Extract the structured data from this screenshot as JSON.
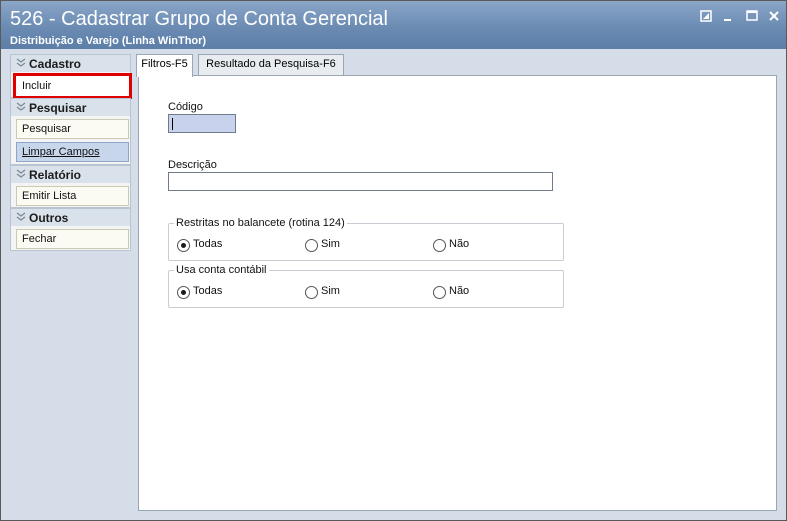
{
  "window": {
    "title": "526 - Cadastrar Grupo de Conta Gerencial",
    "subtitle": "Distribuição e Varejo (Linha WinThor)"
  },
  "sidebar": {
    "groups": [
      {
        "title": "Cadastro",
        "items": [
          {
            "label": "Incluir",
            "highlighted": true
          }
        ]
      },
      {
        "title": "Pesquisar",
        "items": [
          {
            "label": "Pesquisar"
          },
          {
            "label": "Limpar Campos",
            "active": true
          }
        ]
      },
      {
        "title": "Relatório",
        "items": [
          {
            "label": "Emitir Lista"
          }
        ]
      },
      {
        "title": "Outros",
        "items": [
          {
            "label": "Fechar"
          }
        ]
      }
    ]
  },
  "tabs": [
    {
      "label": "Filtros-F5",
      "selected": true
    },
    {
      "label": "Resultado da Pesquisa-F6",
      "selected": false
    }
  ],
  "form": {
    "codigo_label": "Código",
    "codigo_value": "",
    "descricao_label": "Descrição",
    "descricao_value": "",
    "restritas": {
      "legend": "Restritas no balancete (rotina 124)",
      "options": [
        "Todas",
        "Sim",
        "Não"
      ],
      "selected": "Todas"
    },
    "usa_conta": {
      "legend": "Usa conta contábil",
      "options": [
        "Todas",
        "Sim",
        "Não"
      ],
      "selected": "Todas"
    }
  },
  "colors": {
    "titlebar": "#6b8bb3",
    "highlight_outline": "#e00000",
    "focused_input": "#c8d2ec"
  },
  "icons": {
    "window_controls": [
      "restore-icon",
      "minimize-icon",
      "maximize-icon",
      "close-icon"
    ],
    "group_chevron": "double-chevron-down-icon"
  }
}
